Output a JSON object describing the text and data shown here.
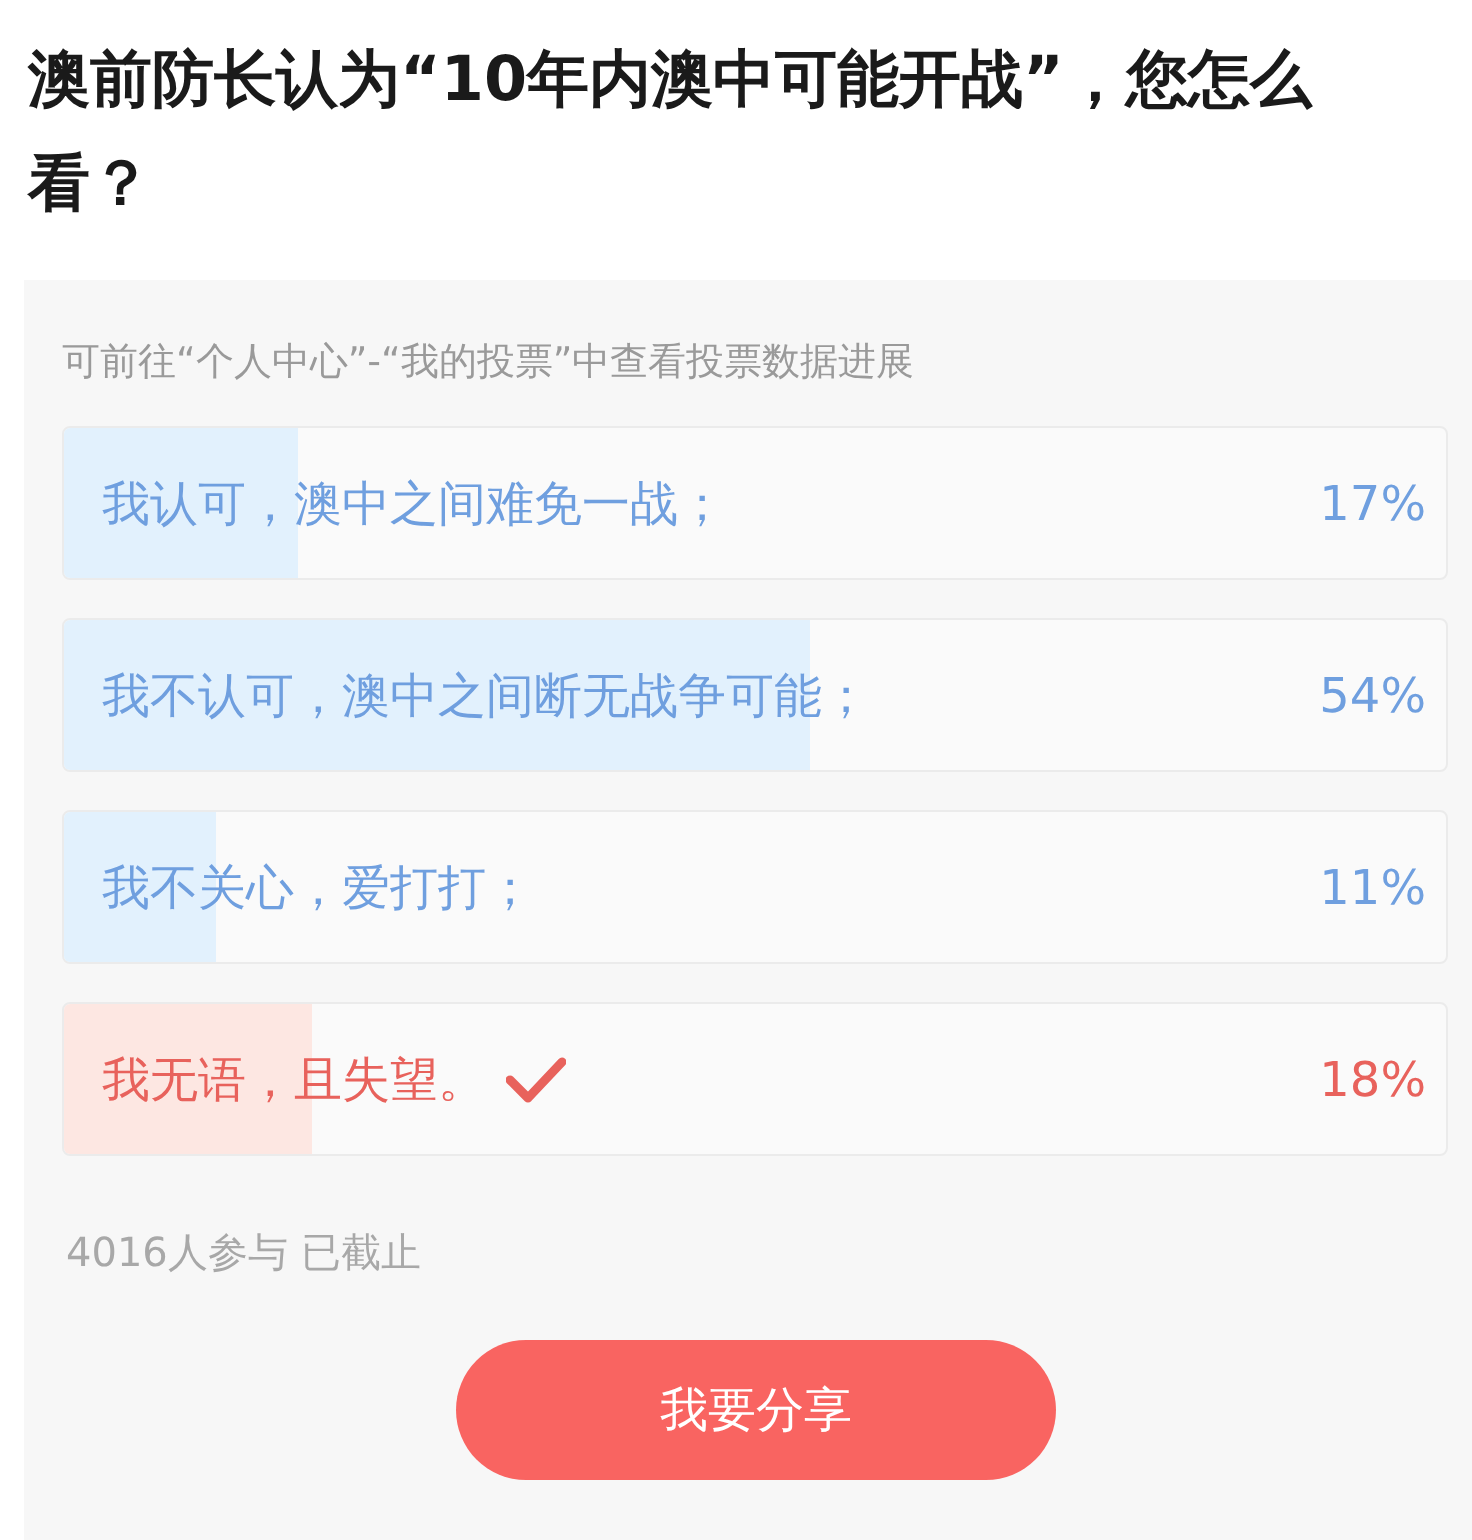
{
  "question": {
    "title": "澳前防长认为“10年内澳中可能开战”，您怎么看？"
  },
  "poll": {
    "hint": "可前往“个人中心”-“我的投票”中查看投票数据进展",
    "options": [
      {
        "label": "我认可，澳中之间难免一战；",
        "percent": "17%",
        "level": 0.17,
        "selected": false
      },
      {
        "label": "我不认可，澳中之间断无战争可能；",
        "percent": "54%",
        "level": 0.54,
        "selected": false
      },
      {
        "label": "我不关心，爱打打；",
        "percent": "11%",
        "level": 0.11,
        "selected": false
      },
      {
        "label": "我无语，且失望。",
        "percent": "18%",
        "level": 0.18,
        "selected": true
      }
    ],
    "footer": "4016人参与 已截止",
    "share_button": "我要分享"
  }
}
